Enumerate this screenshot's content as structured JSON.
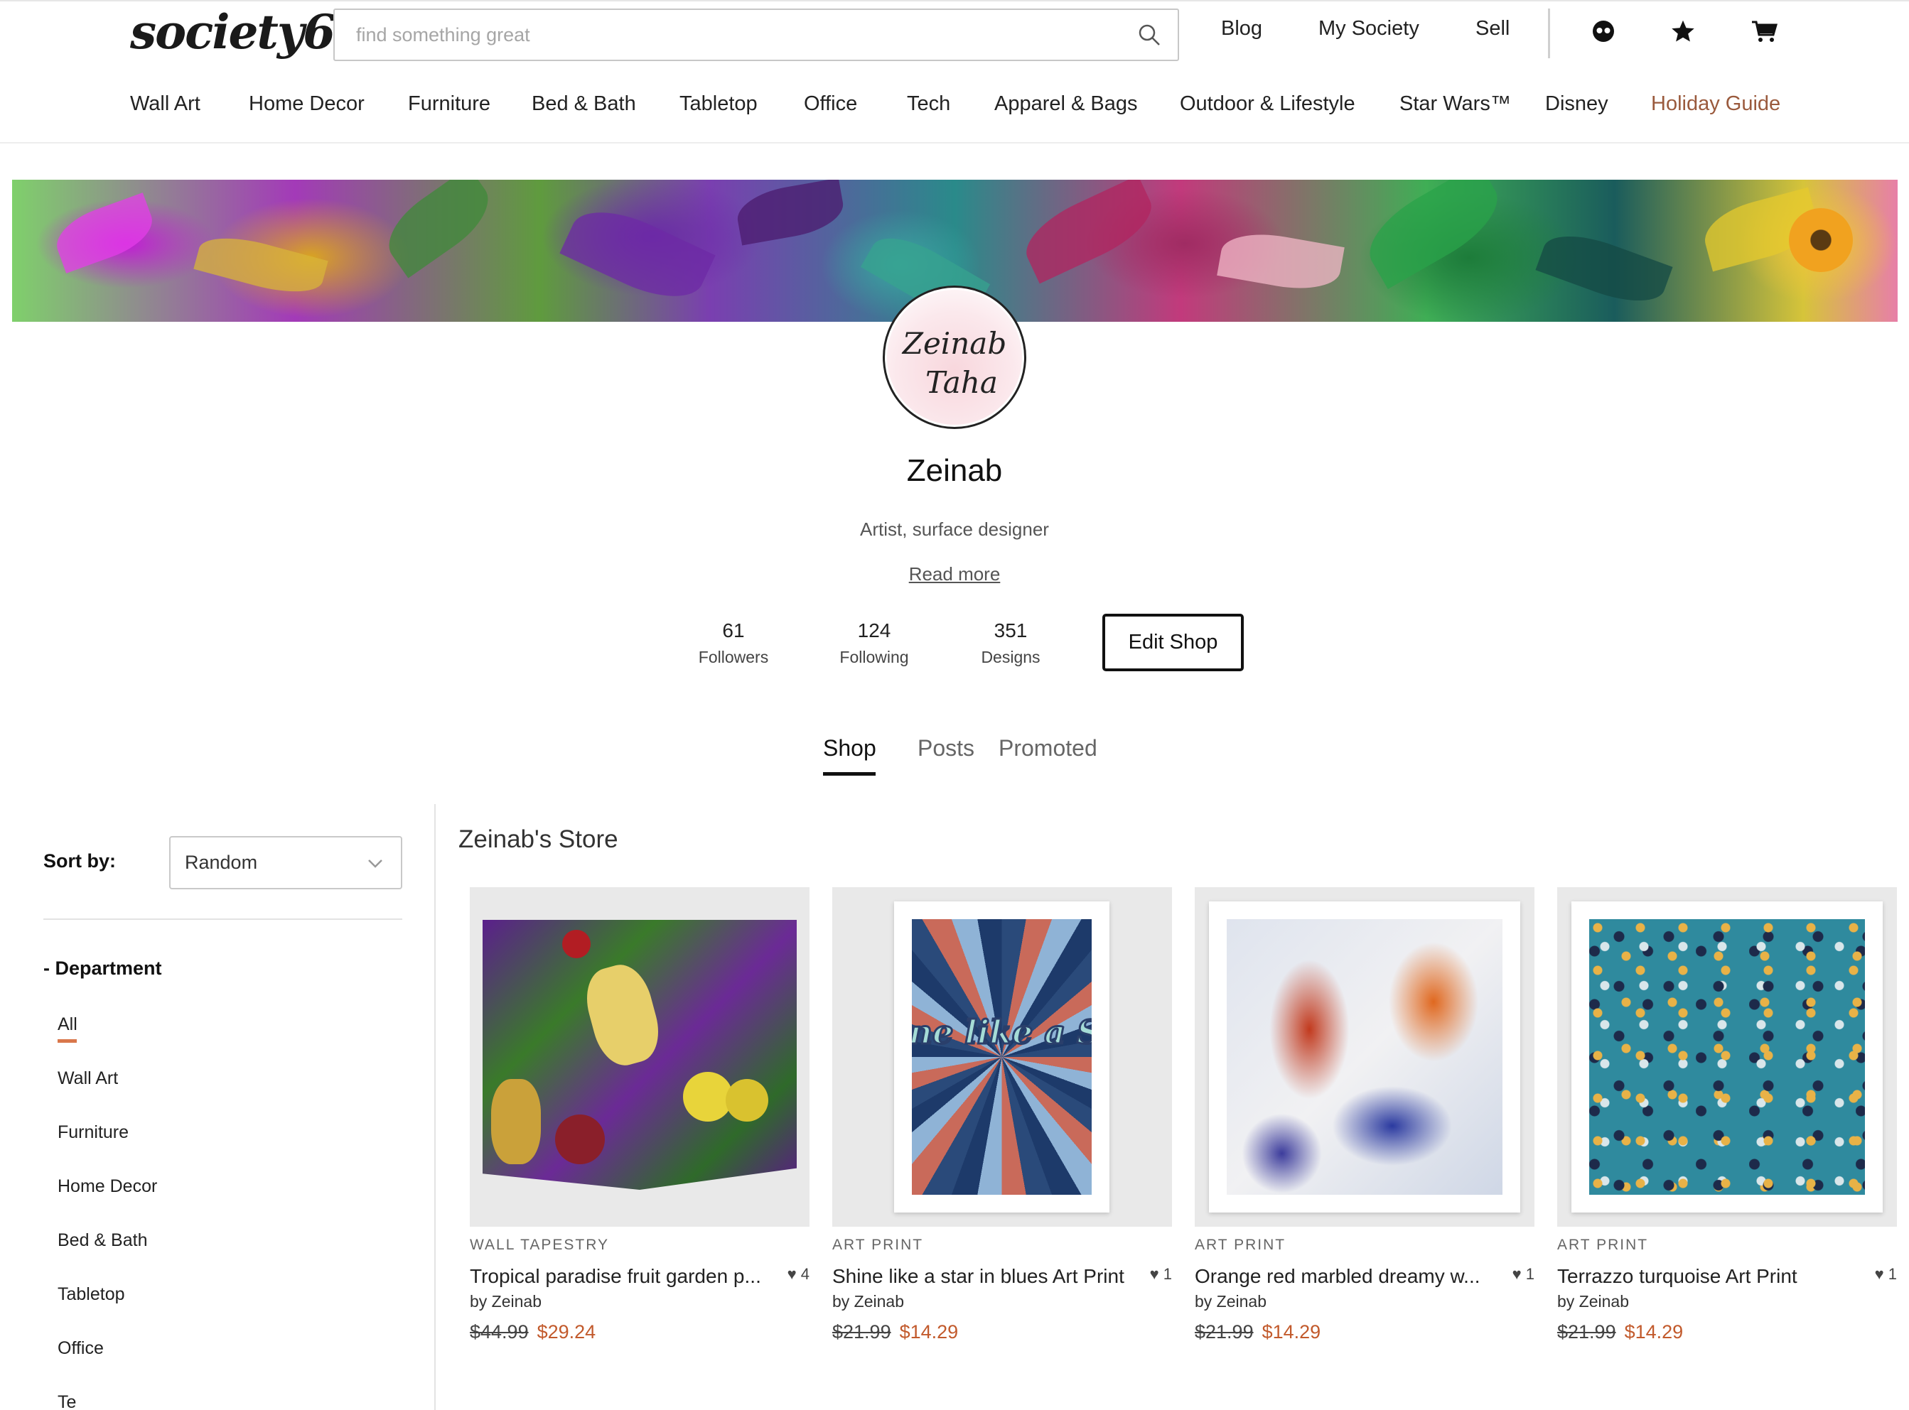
{
  "header": {
    "logo": "society6",
    "search_placeholder": "find something great",
    "links": {
      "blog": "Blog",
      "my_society": "My Society",
      "sell": "Sell"
    },
    "icons": [
      "profile-icon",
      "star-icon",
      "cart-icon"
    ]
  },
  "categories": [
    "Wall Art",
    "Home Decor",
    "Furniture",
    "Bed & Bath",
    "Tabletop",
    "Office",
    "Tech",
    "Apparel & Bags",
    "Outdoor & Lifestyle",
    "Star Wars™",
    "Disney",
    "Holiday Guide"
  ],
  "profile": {
    "avatar_text_line1": "Zeinab",
    "avatar_text_line2": "Taha",
    "name": "Zeinab",
    "bio": "Artist, surface designer",
    "read_more": "Read more",
    "stats": [
      {
        "value": "61",
        "label": "Followers"
      },
      {
        "value": "124",
        "label": "Following"
      },
      {
        "value": "351",
        "label": "Designs"
      }
    ],
    "edit_button": "Edit Shop"
  },
  "tabs": [
    {
      "label": "Shop",
      "active": true
    },
    {
      "label": "Posts",
      "active": false
    },
    {
      "label": "Promoted",
      "active": false
    }
  ],
  "sidebar": {
    "sort_label": "Sort by:",
    "sort_value": "Random",
    "department_label": "- Department",
    "departments": [
      "All",
      "Wall Art",
      "Furniture",
      "Home Decor",
      "Bed & Bath",
      "Tabletop",
      "Office",
      "Te"
    ]
  },
  "store": {
    "title": "Zeinab's Store",
    "products": [
      {
        "category": "WALL TAPESTRY",
        "title": "Tropical paradise fruit garden p...",
        "likes": "4",
        "by": "by Zeinab",
        "old_price": "$44.99",
        "price": "$29.24"
      },
      {
        "category": "ART PRINT",
        "title": "Shine like a star in blues Art Print",
        "likes": "1",
        "by": "by Zeinab",
        "old_price": "$21.99",
        "price": "$14.29",
        "art_text": "Shine like a Star"
      },
      {
        "category": "ART PRINT",
        "title": "Orange red marbled dreamy w...",
        "likes": "1",
        "by": "by Zeinab",
        "old_price": "$21.99",
        "price": "$14.29"
      },
      {
        "category": "ART PRINT",
        "title": "Terrazzo turquoise Art Print",
        "likes": "1",
        "by": "by Zeinab",
        "old_price": "$21.99",
        "price": "$14.29"
      }
    ]
  },
  "colors": {
    "accent": "#c25a2c",
    "holiday": "#9a5a3d",
    "active_bar": "#d9774b"
  }
}
